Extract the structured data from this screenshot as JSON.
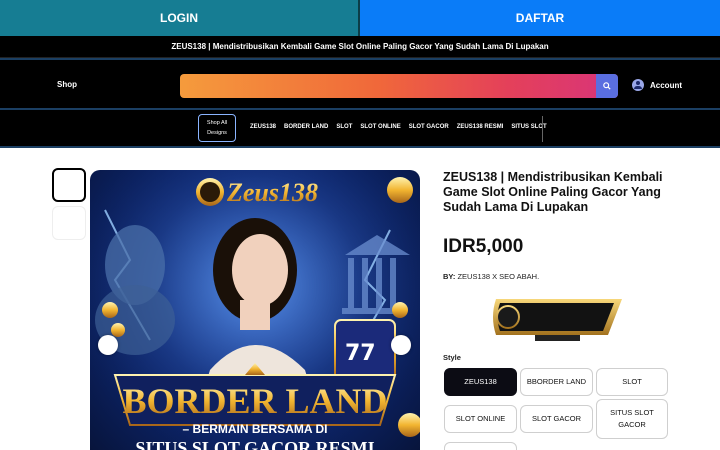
{
  "topbar": {
    "login": "LOGIN",
    "daftar": "DAFTAR"
  },
  "announcement": "ZEUS138 | Mendistribusikan Kembali Game Slot Online Paling Gacor Yang Sudah Lama Di Lupakan",
  "header": {
    "shop": "Shop",
    "account": "Account",
    "search_icon": "search-icon",
    "account_icon": "user-circle-icon"
  },
  "nav": {
    "all_designs": "Shop All Designs",
    "items": [
      "ZEUS138",
      "BORDER LAND",
      "SLOT",
      "SLOT ONLINE",
      "SLOT GACOR",
      "ZEUS138 RESMI",
      "SITUS SLOT"
    ]
  },
  "hero": {
    "logo_text": "Zeus138",
    "banner_title": "BORDER LAND",
    "banner_sub": "– BERMAIN BERSAMA DI",
    "banner_sub2": "SITUS SLOT GACOR RESMI"
  },
  "product": {
    "title": "ZEUS138 | Mendistribusikan Kembali Game Slot Online Paling Gacor Yang Sudah Lama Di Lupakan",
    "price": "IDR5,000",
    "by_label": "BY:",
    "by_value": "ZEUS138 X SEO ABAH.",
    "style_label": "Style",
    "styles": [
      "ZEUS138",
      "BBORDER LAND",
      "SLOT",
      "SLOT ONLINE",
      "SLOT GACOR",
      "SITUS SLOT GACOR"
    ]
  },
  "colors": {
    "login_bg": "#167d93",
    "daftar_bg": "#0a7cf8",
    "dark": "#000000",
    "accent_border": "#1b3f63"
  }
}
